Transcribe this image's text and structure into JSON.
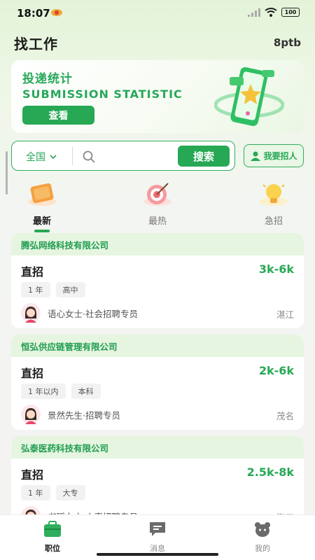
{
  "status_bar": {
    "time": "18:07",
    "battery": "100"
  },
  "header": {
    "title": "找工作",
    "account": "8ptb"
  },
  "banner": {
    "title": "投递统计",
    "subtitle": "SUBMISSION STATISTIC",
    "button": "查看"
  },
  "search": {
    "region": "全国",
    "placeholder": "",
    "button": "搜索"
  },
  "recruit_button": "我要招人",
  "tabs": [
    {
      "label": "最新",
      "active": true
    },
    {
      "label": "最热",
      "active": false
    },
    {
      "label": "急招",
      "active": false
    }
  ],
  "jobs": [
    {
      "company": "腾弘网络科技有限公司",
      "title": "直招",
      "salary": "3k-6k",
      "tags": [
        "1 年",
        "高中"
      ],
      "recruiter": "语心女士·社会招聘专员",
      "location": "湛江"
    },
    {
      "company": "恒弘供应链管理有限公司",
      "title": "直招",
      "salary": "2k-6k",
      "tags": [
        "1 年以内",
        "本科"
      ],
      "recruiter": "景然先生·招聘专员",
      "location": "茂名"
    },
    {
      "company": "弘泰医药科技有限公司",
      "title": "直招",
      "salary": "2.5k-8k",
      "tags": [
        "1 年",
        "大专"
      ],
      "recruiter": "书瑶女士·人事招聘专员",
      "location": "海口"
    }
  ],
  "bottom_nav": [
    {
      "label": "职位",
      "icon": "briefcase-icon",
      "active": true
    },
    {
      "label": "消息",
      "icon": "message-icon",
      "active": false
    },
    {
      "label": "我的",
      "icon": "profile-icon",
      "active": false
    }
  ],
  "colors": {
    "accent": "#27a855",
    "card_head_bg": "#e6f5e0"
  }
}
